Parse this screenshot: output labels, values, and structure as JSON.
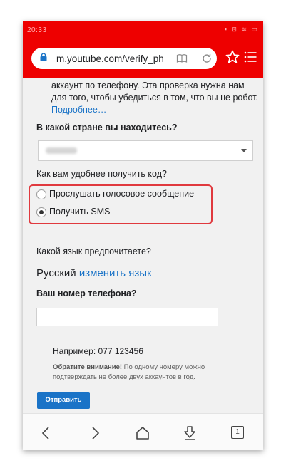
{
  "status_bar": {
    "time": "20:33",
    "icons_text": "▪ ⊡ ≋ ▭"
  },
  "browser": {
    "url": "m.youtube.com/verify_ph"
  },
  "page": {
    "intro_text": "аккаунт по телефону. Эта проверка нужна нам для того, чтобы убедиться в том, что вы не робот.",
    "more_link": "Подробнее…",
    "country_question": "В какой стране вы находитесь?",
    "code_question": "Как вам удобнее получить код?",
    "options": [
      {
        "label": "Прослушать голосовое сообщение",
        "selected": false
      },
      {
        "label": "Получить SMS",
        "selected": true
      }
    ],
    "language_question": "Какой язык предпочитаете?",
    "current_language": "Русский",
    "change_language_link": "изменить язык",
    "phone_question": "Ваш номер телефона?",
    "phone_value": "",
    "example": "Например: 077 123456",
    "note_bold": "Обратите внимание!",
    "note_text": " По одному номеру можно подтверждать не более двух аккаунтов в год.",
    "submit_label": "Отправить"
  },
  "nav": {
    "tabs_count": "1"
  },
  "colors": {
    "toolbar": "#ee0000",
    "link": "#1a73c7",
    "highlight": "#e0393e"
  }
}
